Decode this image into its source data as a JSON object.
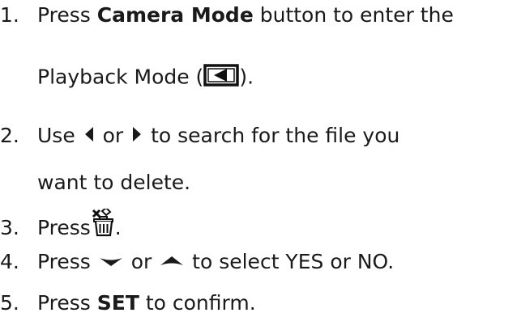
{
  "steps": [
    {
      "number": "1.",
      "prefix": "Press ",
      "bold": "Camera Mode",
      "suffix": " button to enter the",
      "continuation_prefix": "Playback Mode (",
      "icon": "playback-mode-icon",
      "continuation_suffix": ")."
    },
    {
      "number": "2.",
      "prefix": "Use ",
      "icon_left": "left-arrow-icon",
      "middle": " or ",
      "icon_right": "right-arrow-icon",
      "suffix": " to search for the file you",
      "continuation": "want to delete."
    },
    {
      "number": "3.",
      "prefix": "Press",
      "icon": "delete-trash-icon",
      "suffix": "."
    },
    {
      "number": "4.",
      "prefix": "Press ",
      "icon_down": "down-arrow-icon",
      "middle": " or ",
      "icon_up": "up-arrow-icon",
      "suffix": " to select YES or NO."
    },
    {
      "number": "5.",
      "prefix": "Press ",
      "bold": "SET",
      "suffix": " to confirm."
    }
  ]
}
